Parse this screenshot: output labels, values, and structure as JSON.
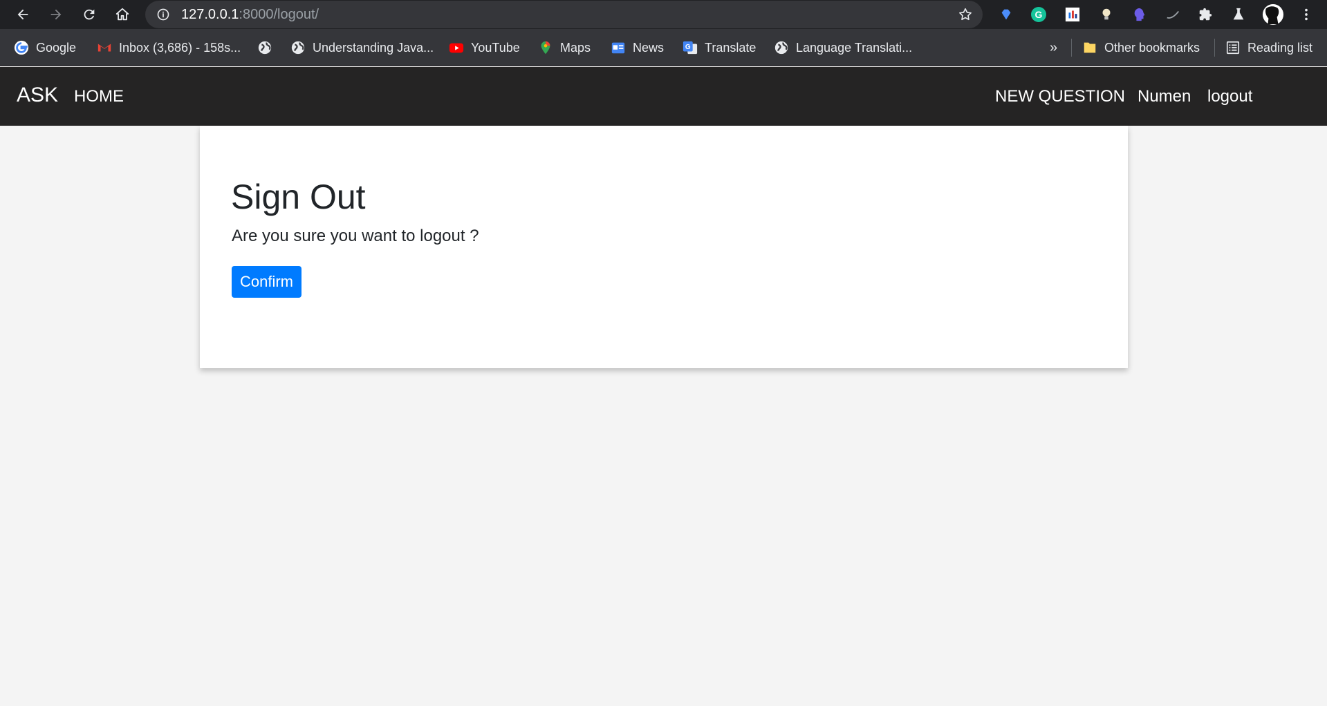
{
  "browser": {
    "url_host": "127.0.0.1",
    "url_path": ":8000/logout/",
    "bookmarks": [
      {
        "label": "Google",
        "icon": "google-icon"
      },
      {
        "label": "Inbox (3,686) - 158s...",
        "icon": "gmail-icon"
      },
      {
        "label": "",
        "icon": "globe-icon"
      },
      {
        "label": "Understanding Java...",
        "icon": "globe-icon"
      },
      {
        "label": "YouTube",
        "icon": "youtube-icon"
      },
      {
        "label": "Maps",
        "icon": "maps-icon"
      },
      {
        "label": "News",
        "icon": "news-icon"
      },
      {
        "label": "Translate",
        "icon": "translate-icon"
      },
      {
        "label": "Language Translati...",
        "icon": "globe-icon"
      }
    ],
    "overflow_label": "»",
    "other_bookmarks": "Other bookmarks",
    "reading_list": "Reading list"
  },
  "navbar": {
    "brand": "ASK",
    "home": "HOME",
    "new_question": "NEW QUESTION",
    "username": "Numen",
    "logout": "logout"
  },
  "main": {
    "title": "Sign Out",
    "message": "Are you sure you want to logout ?",
    "confirm_label": "Confirm"
  },
  "colors": {
    "navbar_bg": "#252424",
    "primary": "#007bff",
    "page_bg": "#f4f4f4"
  }
}
